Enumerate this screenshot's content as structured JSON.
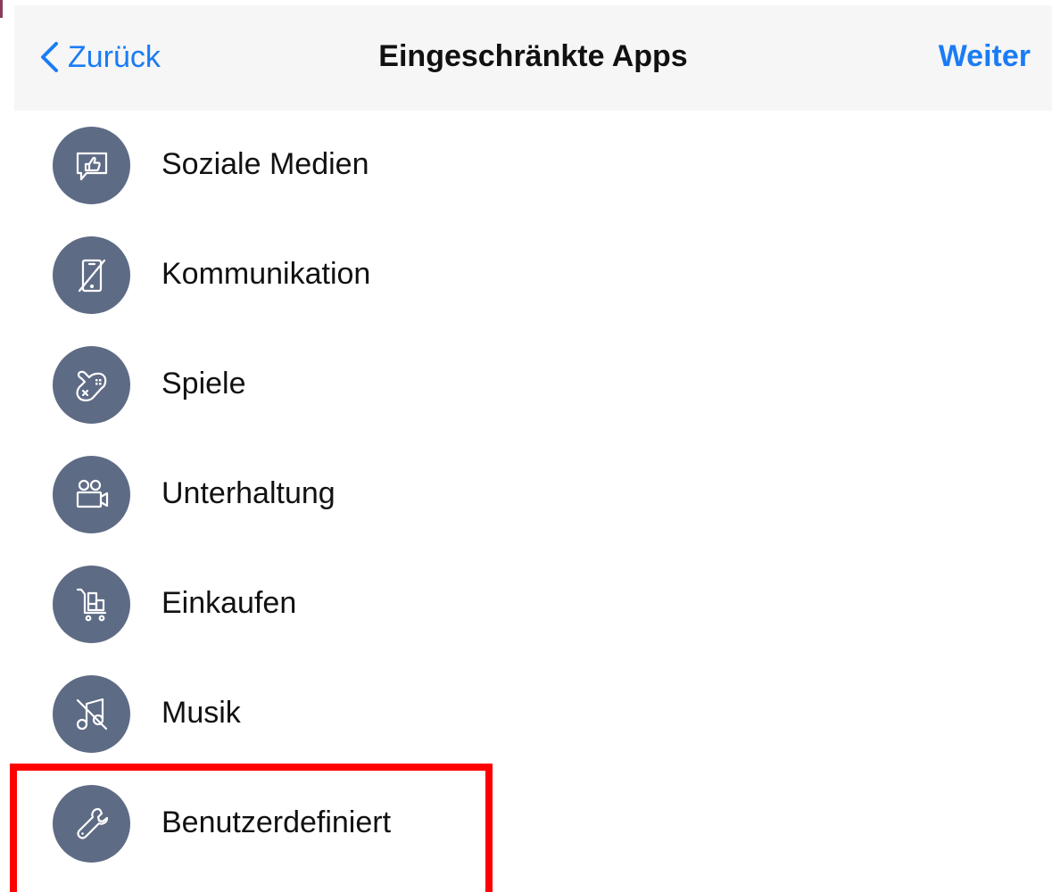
{
  "nav": {
    "back_label": "Zurück",
    "title": "Eingeschränkte Apps",
    "next_label": "Weiter"
  },
  "categories": [
    {
      "label": "Soziale Medien",
      "icon": "social-media-icon"
    },
    {
      "label": "Kommunikation",
      "icon": "communication-icon"
    },
    {
      "label": "Spiele",
      "icon": "games-icon"
    },
    {
      "label": "Unterhaltung",
      "icon": "entertainment-icon"
    },
    {
      "label": "Einkaufen",
      "icon": "shopping-icon"
    },
    {
      "label": "Musik",
      "icon": "music-icon"
    },
    {
      "label": "Benutzerdefiniert",
      "icon": "wrench-icon"
    }
  ],
  "colors": {
    "accent": "#1a7cf5",
    "icon_bg": "#5e6b85",
    "highlight": "#ff0000"
  }
}
